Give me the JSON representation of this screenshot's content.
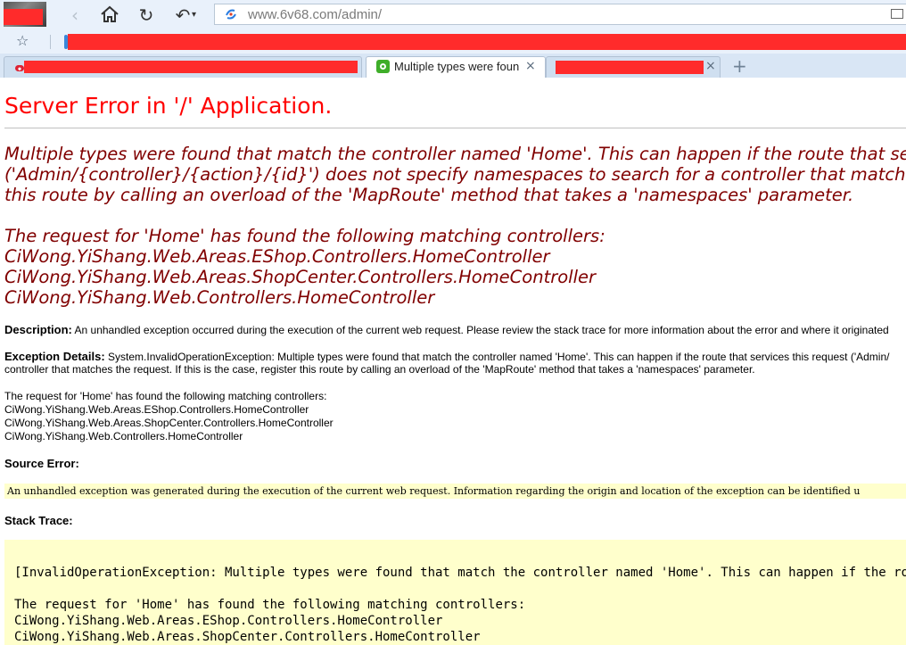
{
  "browser": {
    "url": "www.6v68.com/admin/",
    "tabs": [
      {
        "title": ""
      },
      {
        "title": "Multiple types were foun",
        "active": true
      },
      {
        "title": ""
      }
    ],
    "tab_close_glyph": "×",
    "new_tab_glyph": "+"
  },
  "page": {
    "title": "Server Error in '/' Application.",
    "error_message_lines": [
      "Multiple types were found that match the controller named 'Home'. This can happen if the route that servic",
      "('Admin/{controller}/{action}/{id}') does not specify namespaces to search for a controller that matches t",
      "this route by calling an overload of the 'MapRoute' method that takes a 'namespaces' parameter."
    ],
    "controllers_heading": "The request for 'Home' has found the following matching controllers:",
    "controllers": [
      "CiWong.YiShang.Web.Areas.EShop.Controllers.HomeController",
      "CiWong.YiShang.Web.Areas.ShopCenter.Controllers.HomeController",
      "CiWong.YiShang.Web.Controllers.HomeController"
    ],
    "description_label": "Description:",
    "description_text": "An unhandled exception occurred during the execution of the current web request. Please review the stack trace for more information about the error and where it originated",
    "exception_label": "Exception Details:",
    "exception_line_1": "System.InvalidOperationException: Multiple types were found that match the controller named 'Home'. This can happen if the route that services this request ('Admin/",
    "exception_line_2": "controller that matches the request. If this is the case, register this route by calling an overload of the 'MapRoute' method that takes a 'namespaces' parameter.",
    "source_error_label": "Source Error:",
    "source_error_text": "An unhandled exception was generated during the execution of the current web request. Information regarding the origin and location of the exception can be identified u",
    "stack_trace_label": "Stack Trace:",
    "stack_lines": [
      "[InvalidOperationException: Multiple types were found that match the controller named 'Home'. This can happen if the route t",
      "The request for 'Home' has found the following matching controllers:",
      "CiWong.YiShang.Web.Areas.EShop.Controllers.HomeController",
      "CiWong.YiShang.Web.Areas.ShopCenter.Controllers.HomeController"
    ]
  },
  "colors": {
    "title": "#ff0000",
    "message": "#800000",
    "code_background": "#ffffcc"
  },
  "icons": {
    "back": "back-arrow-icon",
    "home": "home-icon",
    "reload": "reload-icon",
    "undo": "undo-icon",
    "bookmark": "star-icon",
    "mail": "mail-icon"
  }
}
